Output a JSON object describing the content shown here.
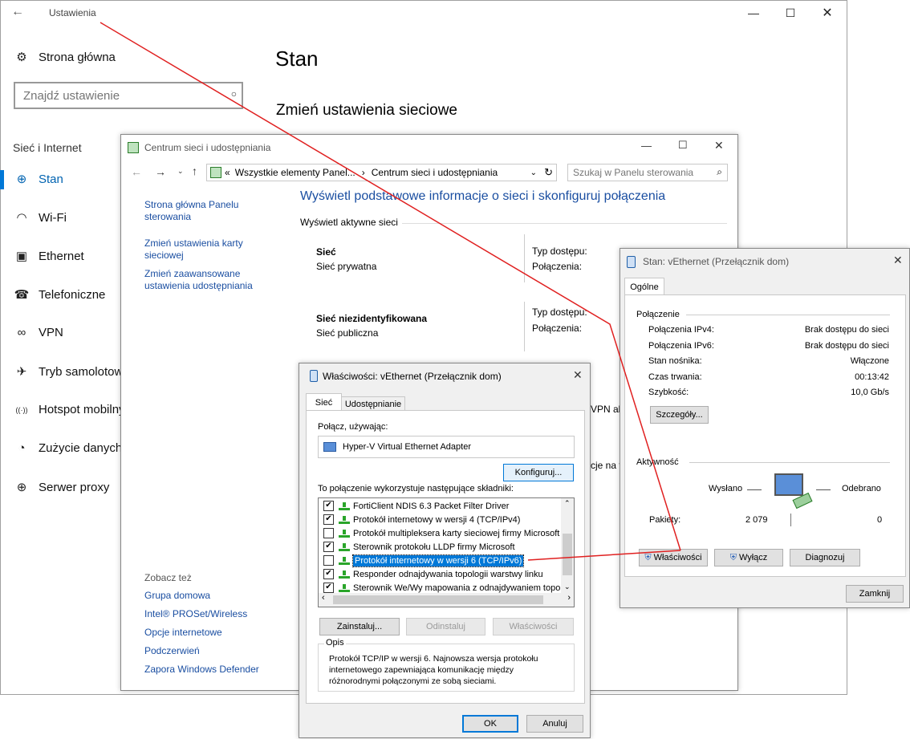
{
  "settings": {
    "title": "Ustawienia",
    "home": "Strona główna",
    "search_placeholder": "Znajdź ustawienie",
    "section": "Sieć i Internet",
    "nav": [
      {
        "label": "Stan",
        "icon": "globe-icon"
      },
      {
        "label": "Wi-Fi",
        "icon": "wifi-icon"
      },
      {
        "label": "Ethernet",
        "icon": "ethernet-icon"
      },
      {
        "label": "Telefoniczne",
        "icon": "dialup-icon"
      },
      {
        "label": "VPN",
        "icon": "vpn-icon"
      },
      {
        "label": "Tryb samolotowy",
        "icon": "airplane-icon"
      },
      {
        "label": "Hotspot mobilny",
        "icon": "hotspot-icon"
      },
      {
        "label": "Zużycie danych",
        "icon": "data-usage-icon"
      },
      {
        "label": "Serwer proxy",
        "icon": "proxy-icon"
      }
    ],
    "page_title": "Stan",
    "subheading": "Zmień ustawienia sieciowe"
  },
  "ncenter": {
    "title": "Centrum sieci i udostępniania",
    "breadcrumb_prefix": "«",
    "breadcrumb_1": "Wszystkie elementy Panel...",
    "breadcrumb_sep": "›",
    "breadcrumb_2": "Centrum sieci i udostępniania",
    "search_placeholder": "Szukaj w Panelu sterowania",
    "left_links": [
      "Strona główna Panelu sterowania",
      "Zmień ustawienia karty sieciowej",
      "Zmień zaawansowane ustawienia udostępniania"
    ],
    "see_also": "Zobacz też",
    "see_also_links": [
      "Grupa domowa",
      "Intel® PROSet/Wireless",
      "Opcje internetowe",
      "Podczerwień",
      "Zapora Windows Defender"
    ],
    "heading": "Wyświetl podstawowe informacje o sieci i skonfiguruj połączenia",
    "active": "Wyświetl aktywne sieci",
    "networks": [
      {
        "name": "Sieć",
        "type": "Sieć prywatna",
        "access_label": "Typ dostępu:",
        "conn_label": "Połączenia:"
      },
      {
        "name": "Sieć niezidentyfikowana",
        "type": "Sieć publiczna",
        "access_label": "Typ dostępu:",
        "conn_label": "Połączenia:"
      }
    ],
    "partial_1": "VPN all",
    "partial_2": "cje na t"
  },
  "status": {
    "title": "Stan: vEthernet (Przełącznik dom)",
    "tab": "Ogólne",
    "conn_section": "Połączenie",
    "rows": [
      {
        "label": "Połączenia IPv4:",
        "value": "Brak dostępu do sieci"
      },
      {
        "label": "Połączenia IPv6:",
        "value": "Brak dostępu do sieci"
      },
      {
        "label": "Stan nośnika:",
        "value": "Włączone"
      },
      {
        "label": "Czas trwania:",
        "value": "00:13:42"
      },
      {
        "label": "Szybkość:",
        "value": "10,0 Gb/s"
      }
    ],
    "details_btn": "Szczegóły...",
    "activity": "Aktywność",
    "sent": "Wysłano",
    "received": "Odebrano",
    "packets": "Pakiety:",
    "packets_sent": "2 079",
    "packets_received": "0",
    "btn_props": "Właściwości",
    "btn_disable": "Wyłącz",
    "btn_diagnose": "Diagnozuj",
    "btn_close": "Zamknij"
  },
  "props": {
    "title": "Właściwości: vEthernet (Przełącznik dom)",
    "tabs": [
      "Sieć",
      "Udostępnianie"
    ],
    "connect_using": "Połącz, używając:",
    "adapter": "Hyper-V Virtual Ethernet Adapter",
    "configure": "Konfiguruj...",
    "uses": "To połączenie wykorzystuje następujące składniki:",
    "items": [
      {
        "label": "FortiClient NDIS 6.3 Packet Filter Driver",
        "checked": "✔"
      },
      {
        "label": "Protokół internetowy w wersji 4 (TCP/IPv4)",
        "checked": "✔"
      },
      {
        "label": "Protokół multipleksera karty sieciowej firmy Microsoft",
        "checked": ""
      },
      {
        "label": "Sterownik protokołu LLDP firmy Microsoft",
        "checked": "✔"
      },
      {
        "label": "Protokół internetowy w wersji 6 (TCP/IPv6)",
        "checked": ""
      },
      {
        "label": "Responder odnajdywania topologii warstwy linku",
        "checked": "✔"
      },
      {
        "label": "Sterownik We/Wy mapowania z odnajdywaniem topolo",
        "checked": "✔"
      }
    ],
    "install": "Zainstaluj...",
    "uninstall": "Odinstaluj",
    "properties": "Właściwości",
    "desc_label": "Opis",
    "desc": "Protokół TCP/IP w wersji 6. Najnowsza wersja protokołu internetowego zapewniająca komunikację między różnorodnymi połączonymi ze sobą sieciami.",
    "ok": "OK",
    "cancel": "Anuluj"
  },
  "colors": {
    "accent": "#0078d7",
    "annotation": "#e02020",
    "link": "#1a4ea1",
    "selection": "#0078d7"
  }
}
